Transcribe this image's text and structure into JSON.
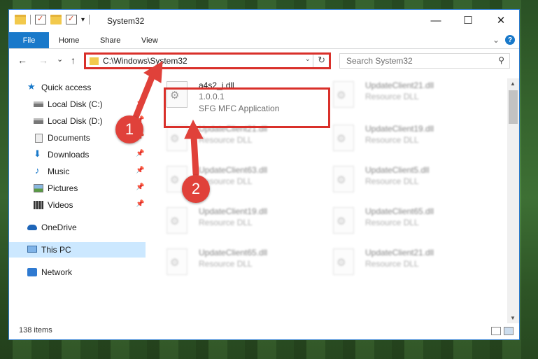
{
  "window": {
    "title": "System32",
    "minimize_glyph": "—",
    "maximize_glyph": "☐",
    "close_glyph": "✕",
    "dropdown_glyph": "▾"
  },
  "ribbon": {
    "tabs": [
      "File",
      "Home",
      "Share",
      "View"
    ],
    "expand_glyph": "⌄",
    "help_glyph": "?"
  },
  "nav": {
    "back_glyph": "←",
    "forward_glyph": "→",
    "recent_glyph": "⌄",
    "up_glyph": "↑",
    "address": "C:\\Windows\\System32",
    "address_drop_glyph": "⌄",
    "refresh_glyph": "↻",
    "search_placeholder": "Search System32",
    "search_glyph": "⚲"
  },
  "sidebar": {
    "items": [
      {
        "label": "Quick access",
        "icon": "star-icon",
        "glyph": "★",
        "pinned": false
      },
      {
        "label": "Local Disk (C:)",
        "icon": "disk-icon",
        "pinned": true
      },
      {
        "label": "Local Disk (D:)",
        "icon": "disk-icon",
        "pinned": true
      },
      {
        "label": "Documents",
        "icon": "documents-icon",
        "pinned": true
      },
      {
        "label": "Downloads",
        "icon": "download-icon",
        "glyph": "⬇",
        "pinned": true
      },
      {
        "label": "Music",
        "icon": "music-icon",
        "glyph": "♪",
        "pinned": true
      },
      {
        "label": "Pictures",
        "icon": "pictures-icon",
        "pinned": true
      },
      {
        "label": "Videos",
        "icon": "videos-icon",
        "pinned": true
      },
      {
        "label": "OneDrive",
        "icon": "cloud-icon",
        "pinned": false
      },
      {
        "label": "This PC",
        "icon": "computer-icon",
        "pinned": false,
        "selected": true
      },
      {
        "label": "Network",
        "icon": "network-icon",
        "pinned": false
      }
    ],
    "pin_glyph": "📌"
  },
  "files": [
    {
      "name": "a4s2_j.dll",
      "line1": "1.0.0.1",
      "line2": "SFG MFC Application",
      "highlighted": true
    },
    {
      "name": "UpdateClient21.dll",
      "line1": "Resource DLL"
    },
    {
      "name": "UpdateClient21.dll",
      "line1": "Resource DLL"
    },
    {
      "name": "UpdateClient19.dll",
      "line1": "Resource DLL"
    },
    {
      "name": "UpdateClient63.dll",
      "line1": "Resource DLL"
    },
    {
      "name": "UpdateClient5.dll",
      "line1": "Resource DLL"
    },
    {
      "name": "UpdateClient19.dll",
      "line1": "Resource DLL"
    },
    {
      "name": "UpdateClient65.dll",
      "line1": "Resource DLL"
    },
    {
      "name": "UpdateClient65.dll",
      "line1": "Resource DLL"
    },
    {
      "name": "UpdateClient21.dll",
      "line1": "Resource DLL"
    }
  ],
  "status": {
    "item_count": "138 items"
  },
  "scroll": {
    "up_glyph": "▲",
    "down_glyph": "▼"
  },
  "annotations": {
    "step1": "1",
    "step2": "2",
    "color": "#d9302a"
  }
}
